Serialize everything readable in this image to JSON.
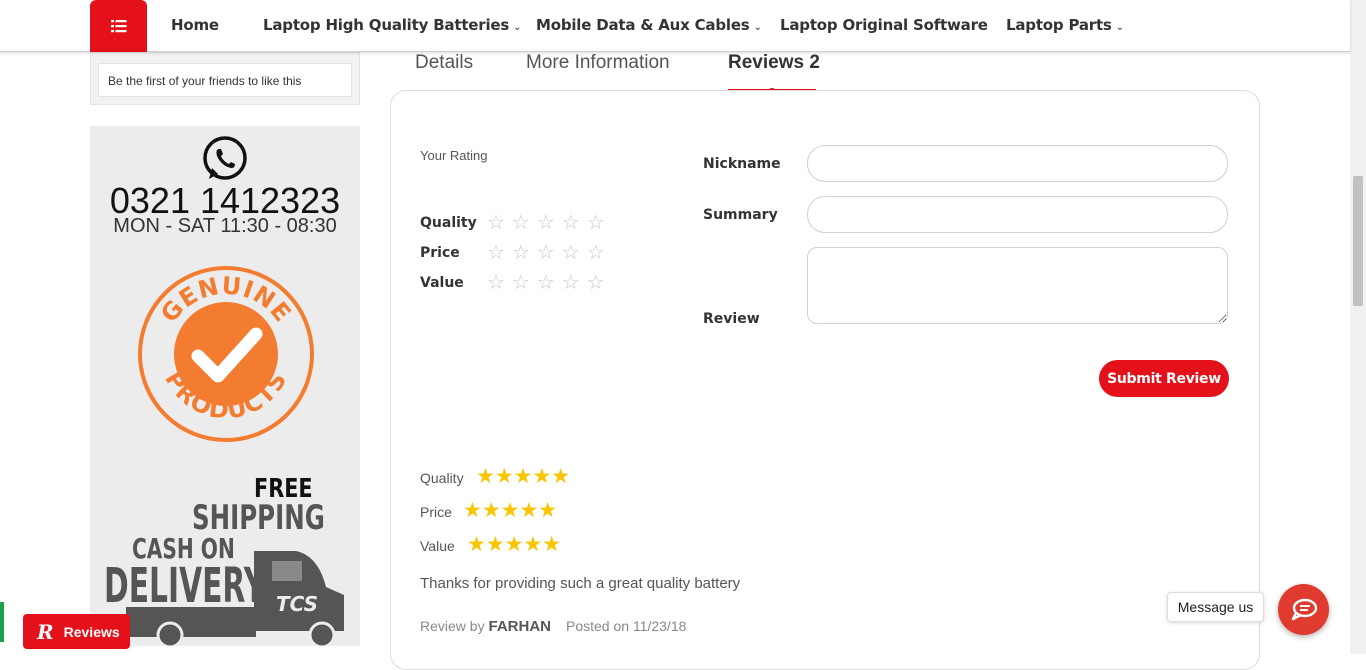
{
  "nav": {
    "items": [
      {
        "label": "Home"
      },
      {
        "label": "Laptop High Quality Batteries",
        "dropdown": true
      },
      {
        "label": "Mobile Data & Aux Cables",
        "dropdown": true
      },
      {
        "label": "Laptop Original Software"
      },
      {
        "label": "Laptop Parts",
        "dropdown": true
      }
    ],
    "chevron": "⌄"
  },
  "sidebar": {
    "facebook_text": "Be the first of your friends to like this",
    "phone": "0321 1412323",
    "hours": "MON - SAT 11:30 - 08:30",
    "badge_top": "GENUINE",
    "badge_bottom": "PRODUCTS",
    "free": "FREE",
    "shipping": "SHIPPING",
    "cash_on": "CASH ON",
    "delivery": "DELIVERY",
    "truck_logo": "TCS"
  },
  "tabs": [
    {
      "label": "Details"
    },
    {
      "label": "More Information"
    },
    {
      "label": "Reviews 2",
      "active": true
    }
  ],
  "review_form": {
    "your_rating": "Your Rating",
    "ratings": [
      {
        "label": "Quality",
        "stars": "☆☆☆☆☆"
      },
      {
        "label": "Price",
        "stars": "☆☆☆☆☆"
      },
      {
        "label": "Value",
        "stars": "☆☆☆☆☆"
      }
    ],
    "nickname_label": "Nickname",
    "nickname_value": "",
    "summary_label": "Summary",
    "summary_value": "",
    "review_label": "Review",
    "review_value": "",
    "submit_label": "Submit Review"
  },
  "review": {
    "ratings": [
      {
        "label": "Quality",
        "stars": "★★★★★",
        "value": 5
      },
      {
        "label": "Price",
        "stars": "★★★★★",
        "value": 5
      },
      {
        "label": "Value",
        "stars": "★★★★★",
        "value": 5
      }
    ],
    "text": "Thanks for providing such a great quality battery",
    "review_by": "Review by",
    "author": "FARHAN",
    "posted": "Posted on 11/23/18"
  },
  "widgets": {
    "reviews_badge_icon": "R",
    "reviews_badge_label": "Reviews",
    "message_us": "Message us"
  },
  "colors": {
    "accent": "#e4111b",
    "star": "#f7c600",
    "badge_orange": "#f47c30"
  }
}
